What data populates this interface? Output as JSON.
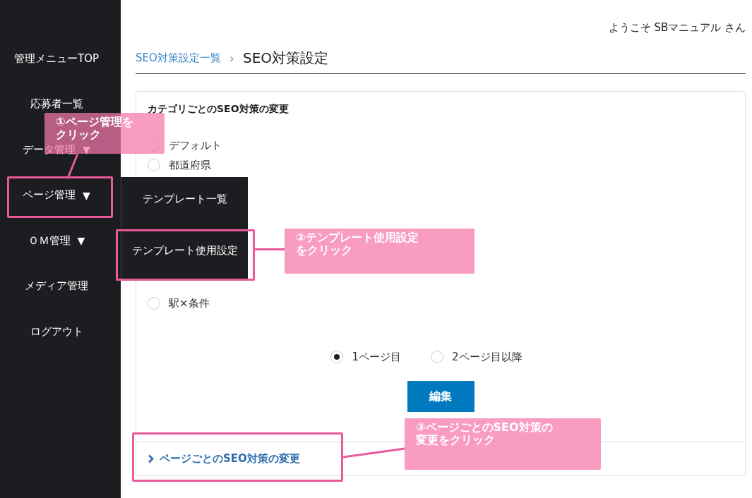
{
  "sidebar": {
    "items": [
      {
        "label": "管理メニューTOP"
      },
      {
        "label": "応募者一覧"
      },
      {
        "label": "データ管理",
        "caret": "▼"
      },
      {
        "label": "ページ管理",
        "caret": "▼"
      },
      {
        "label": "ＯＭ管理",
        "caret": "▼"
      },
      {
        "label": "メディア管理"
      },
      {
        "label": "ログアウト"
      }
    ]
  },
  "dropdown": {
    "items": [
      {
        "label": "テンプレート一覧"
      },
      {
        "label": "テンプレート使用設定"
      }
    ]
  },
  "header": {
    "welcome": "ようこそ SBマニュアル さん"
  },
  "breadcrumb": {
    "link": "SEO対策設定一覧",
    "separator": "›",
    "current": "SEO対策設定"
  },
  "card": {
    "title": "カテゴリごとのSEO対策の変更",
    "category_options": [
      {
        "label": "デフォルト",
        "selected": false
      },
      {
        "label": "都道府県",
        "selected": false
      }
    ],
    "category_options_below_menu": [
      {
        "label": "駅×条件",
        "selected": false
      }
    ],
    "page_options": [
      {
        "label": "1ページ目",
        "selected": true
      },
      {
        "label": "2ページ目以降",
        "selected": false
      }
    ],
    "edit_button": "編集",
    "section_link": "ページごとのSEO対策の変更"
  },
  "annotations": [
    {
      "text": "①ページ管理をクリック"
    },
    {
      "text": "②テンプレート使用設定をクリック"
    },
    {
      "text": "③ページごとのSEO対策の変更をクリック"
    }
  ]
}
